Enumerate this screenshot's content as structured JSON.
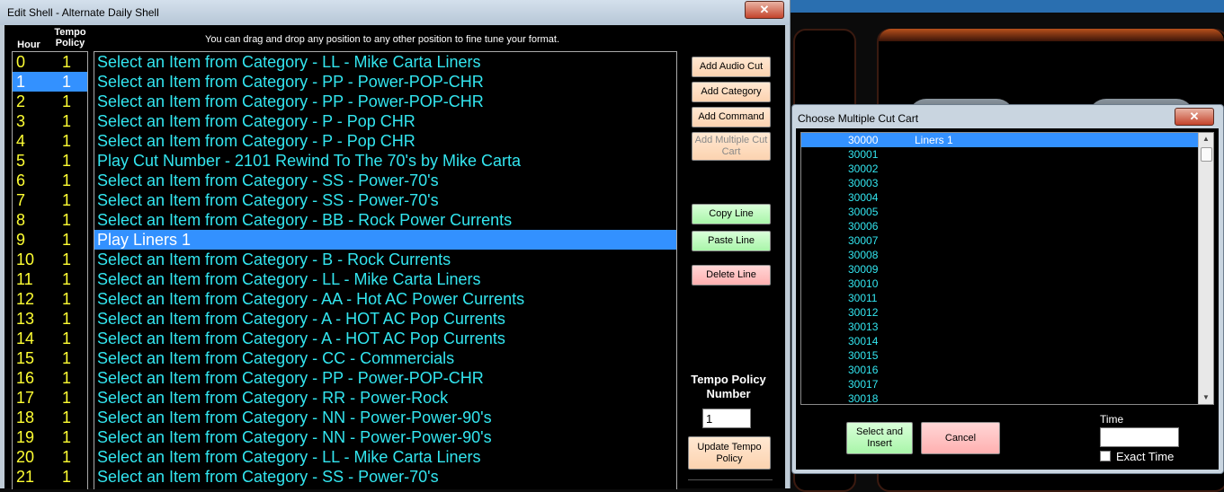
{
  "edit_shell": {
    "title": "Edit Shell - Alternate Daily Shell",
    "close_glyph": "✕",
    "col_hour": "Hour",
    "col_tempo": "Tempo Policy",
    "instruction": "You can drag and drop any position to any other position to fine tune your format.",
    "rows": [
      {
        "hour": "0",
        "policy": "1",
        "item": "Select an Item from Category - LL - Mike Carta Liners"
      },
      {
        "hour": "1",
        "policy": "1",
        "item": "Select an Item from Category - PP - Power-POP-CHR"
      },
      {
        "hour": "2",
        "policy": "1",
        "item": "Select an Item from Category - PP - Power-POP-CHR"
      },
      {
        "hour": "3",
        "policy": "1",
        "item": "Select an Item from Category - P - Pop CHR"
      },
      {
        "hour": "4",
        "policy": "1",
        "item": "Select an Item from Category - P - Pop CHR"
      },
      {
        "hour": "5",
        "policy": "1",
        "item": "Play Cut Number - 2101 Rewind To The 70's by Mike Carta"
      },
      {
        "hour": "6",
        "policy": "1",
        "item": "Select an Item from Category - SS - Power-70's"
      },
      {
        "hour": "7",
        "policy": "1",
        "item": "Select an Item from Category - SS - Power-70's"
      },
      {
        "hour": "8",
        "policy": "1",
        "item": "Select an Item from Category - BB - Rock Power Currents"
      },
      {
        "hour": "9",
        "policy": "1",
        "item": "Play  Liners 1"
      },
      {
        "hour": "10",
        "policy": "1",
        "item": "Select an Item from Category - B - Rock Currents"
      },
      {
        "hour": "11",
        "policy": "1",
        "item": "Select an Item from Category - LL - Mike Carta Liners"
      },
      {
        "hour": "12",
        "policy": "1",
        "item": "Select an Item from Category - AA - Hot AC Power Currents"
      },
      {
        "hour": "13",
        "policy": "1",
        "item": "Select an Item from Category - A - HOT AC Pop Currents"
      },
      {
        "hour": "14",
        "policy": "1",
        "item": "Select an Item from Category - A - HOT AC Pop Currents"
      },
      {
        "hour": "15",
        "policy": "1",
        "item": "Select an Item from Category - CC - Commercials"
      },
      {
        "hour": "16",
        "policy": "1",
        "item": "Select an Item from Category - PP - Power-POP-CHR"
      },
      {
        "hour": "17",
        "policy": "1",
        "item": "Select an Item from Category - RR - Power-Rock"
      },
      {
        "hour": "18",
        "policy": "1",
        "item": "Select an Item from Category - NN - Power-Power-90's"
      },
      {
        "hour": "19",
        "policy": "1",
        "item": "Select an Item from Category - NN - Power-Power-90's"
      },
      {
        "hour": "20",
        "policy": "1",
        "item": "Select an Item from Category - LL - Mike Carta Liners"
      },
      {
        "hour": "21",
        "policy": "1",
        "item": "Select an Item from Category - SS - Power-70's"
      }
    ],
    "selected_hour_index": 1,
    "selected_item_index": 9,
    "buttons": {
      "add_audio_cut": "Add Audio Cut",
      "add_category": "Add Category",
      "add_command": "Add Command",
      "add_multiple_cut_cart": "Add Multiple Cut Cart",
      "copy_line": "Copy Line",
      "paste_line": "Paste Line",
      "delete_line": "Delete Line",
      "update_tempo_policy": "Update Tempo Policy"
    },
    "tempo_policy_label": "Tempo Policy Number",
    "tempo_policy_value": "1"
  },
  "cut_cart": {
    "title": "Choose Multiple Cut Cart",
    "close_glyph": "✕",
    "items": [
      {
        "number": "30000",
        "name": "Liners 1"
      },
      {
        "number": "30001",
        "name": ""
      },
      {
        "number": "30002",
        "name": ""
      },
      {
        "number": "30003",
        "name": ""
      },
      {
        "number": "30004",
        "name": ""
      },
      {
        "number": "30005",
        "name": ""
      },
      {
        "number": "30006",
        "name": ""
      },
      {
        "number": "30007",
        "name": ""
      },
      {
        "number": "30008",
        "name": ""
      },
      {
        "number": "30009",
        "name": ""
      },
      {
        "number": "30010",
        "name": ""
      },
      {
        "number": "30011",
        "name": ""
      },
      {
        "number": "30012",
        "name": ""
      },
      {
        "number": "30013",
        "name": ""
      },
      {
        "number": "30014",
        "name": ""
      },
      {
        "number": "30015",
        "name": ""
      },
      {
        "number": "30016",
        "name": ""
      },
      {
        "number": "30017",
        "name": ""
      },
      {
        "number": "30018",
        "name": ""
      }
    ],
    "selected_index": 0,
    "select_insert_label": "Select and Insert",
    "cancel_label": "Cancel",
    "time_label": "Time",
    "time_value": "",
    "exact_time_label": "Exact Time",
    "exact_time_checked": false
  },
  "colors": {
    "item_text": "#33e6f0",
    "hour_text": "#ffff33",
    "selection": "#3391ff"
  }
}
